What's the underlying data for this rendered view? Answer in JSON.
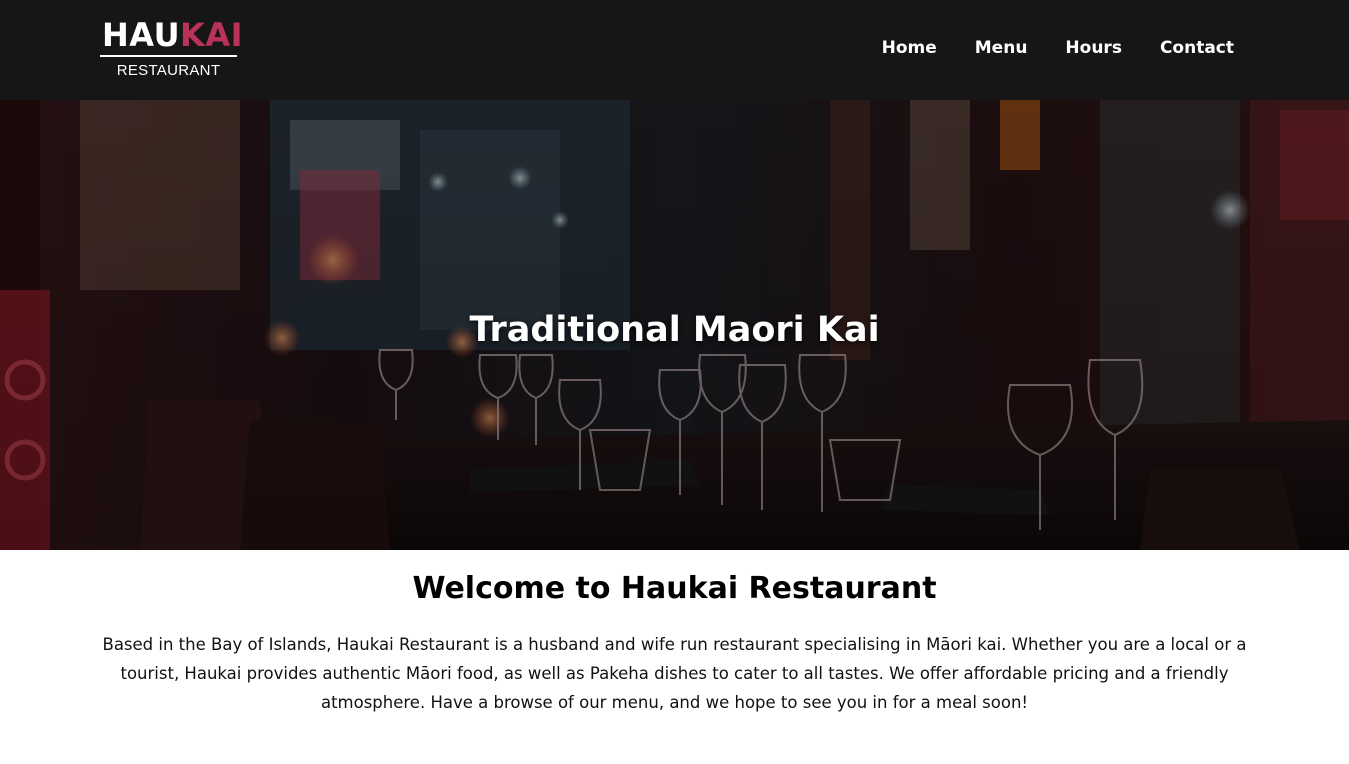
{
  "colors": {
    "navbar_bg": "#161616",
    "brand_accent": "#b8325a",
    "hero_overlay": "#1b0d10"
  },
  "brand": {
    "logo_part1": "HAU",
    "logo_part2": "KAI",
    "logo_sub": "RESTAURANT"
  },
  "nav": {
    "items": [
      {
        "label": "Home"
      },
      {
        "label": "Menu"
      },
      {
        "label": "Hours"
      },
      {
        "label": "Contact"
      }
    ]
  },
  "hero": {
    "title": "Traditional Maori Kai"
  },
  "main": {
    "heading": "Welcome to Haukai Restaurant",
    "intro": "Based in the Bay of Islands, Haukai Restaurant is a husband and wife run restaurant specialising in Māori kai. Whether you are a local or a tourist, Haukai provides authentic Māori food, as well as Pakeha dishes to cater to all tastes. We offer affordable pricing and a friendly atmosphere. Have a browse of our menu, and we hope to see you in for a meal soon!"
  }
}
